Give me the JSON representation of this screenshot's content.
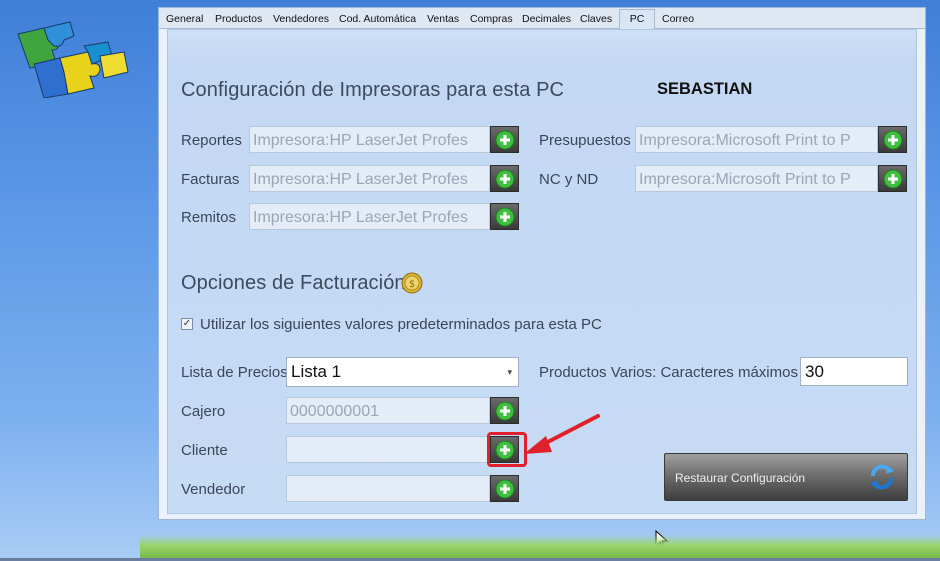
{
  "tabs": [
    {
      "label": "General"
    },
    {
      "label": "Productos"
    },
    {
      "label": "Vendedores"
    },
    {
      "label": "Cod. Automática"
    },
    {
      "label": "Ventas"
    },
    {
      "label": "Compras"
    },
    {
      "label": "Decimales"
    },
    {
      "label": "Claves"
    },
    {
      "label": "PC",
      "active": true
    },
    {
      "label": "Correo"
    }
  ],
  "printers": {
    "title": "Configuración de Impresoras para esta PC",
    "pc_name": "SEBASTIAN",
    "rows": [
      {
        "label": "Reportes",
        "value": "Impresora:HP LaserJet Profes"
      },
      {
        "label": "Facturas",
        "value": "Impresora:HP LaserJet Profes"
      },
      {
        "label": "Remitos",
        "value": "Impresora:HP LaserJet Profes"
      },
      {
        "label": "Presupuestos",
        "value": "Impresora:Microsoft Print to P"
      },
      {
        "label": "NC y ND",
        "value": "Impresora:Microsoft Print to P"
      }
    ]
  },
  "billing": {
    "title": "Opciones de Facturación",
    "use_defaults_label": "Utilizar los siguientes valores predeterminados para esta PC",
    "use_defaults_checked": true,
    "checkmark": "✓",
    "price_list_label": "Lista de Precios",
    "price_list_value": "Lista 1",
    "misc_products_label": "Productos Varios: Caracteres máximos",
    "misc_products_value": "30",
    "cashier_label": "Cajero",
    "cashier_value": "0000000001",
    "client_label": "Cliente",
    "client_value": "",
    "seller_label": "Vendedor",
    "seller_value": ""
  },
  "restore_button": {
    "label": "Restaurar Configuración"
  },
  "colors": {
    "accent_red": "#e0202a",
    "add_green": "#3fbf3f"
  }
}
